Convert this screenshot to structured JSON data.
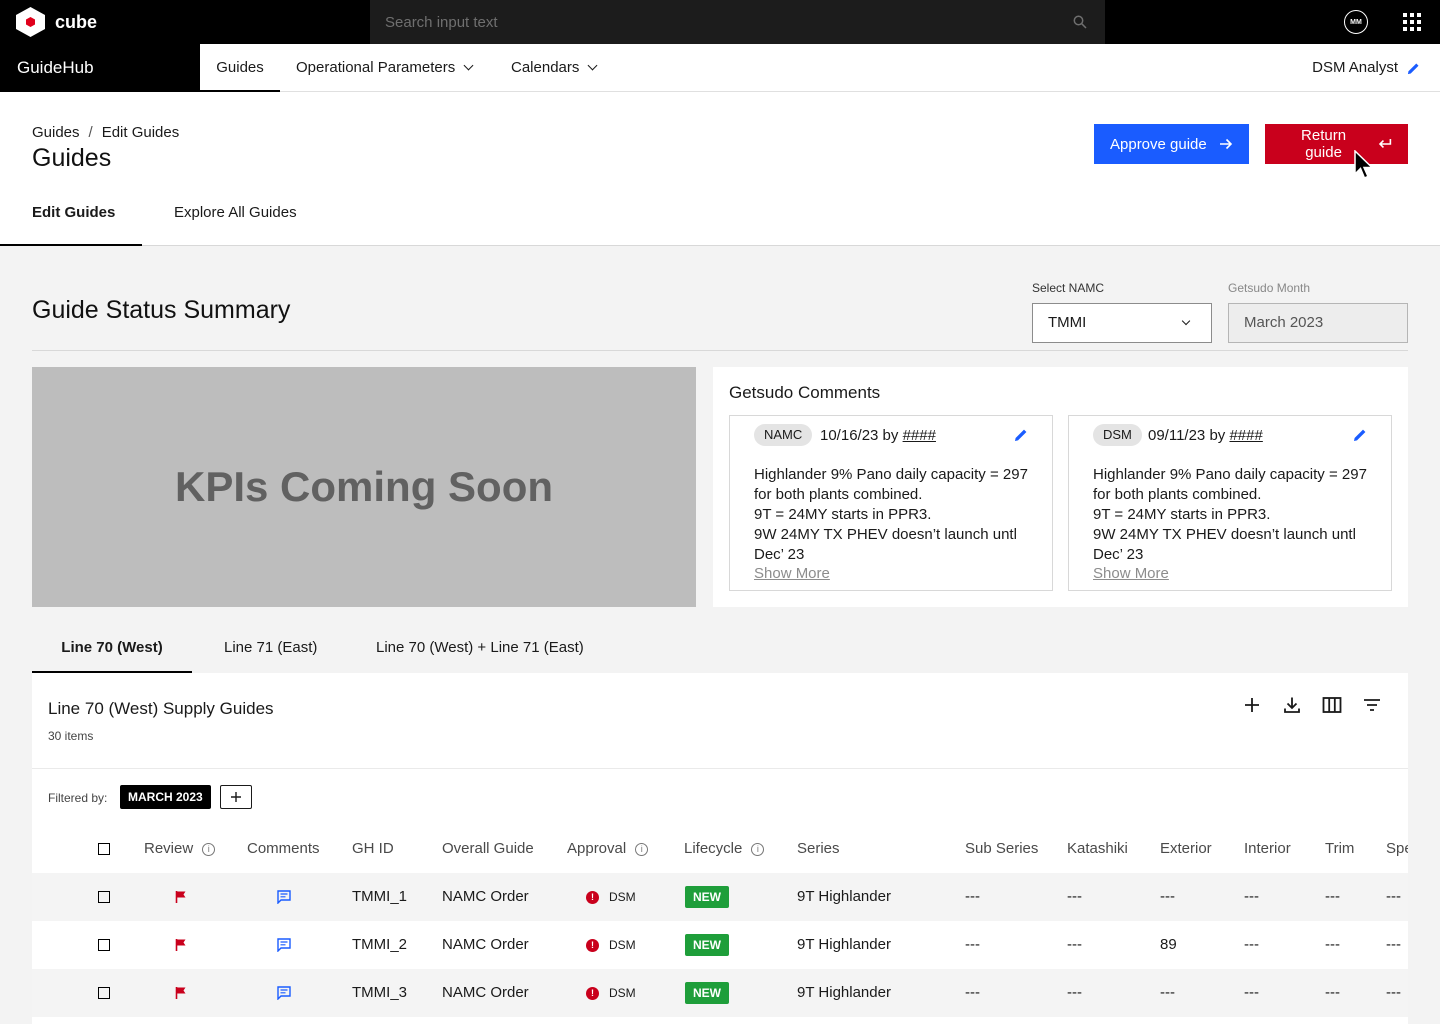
{
  "topbar": {
    "logo_text": "cube",
    "search_placeholder": "Search input text",
    "avatar_initials": "MM"
  },
  "navbar": {
    "brand": "GuideHub",
    "items": [
      {
        "label": "Guides",
        "active": true
      },
      {
        "label": "Operational Parameters",
        "dropdown": true
      },
      {
        "label": "Calendars",
        "dropdown": true
      }
    ],
    "role": "DSM Analyst"
  },
  "header": {
    "breadcrumb": [
      "Guides",
      "Edit Guides"
    ],
    "title": "Guides",
    "approve_label": "Approve guide",
    "return_label": "Return guide",
    "tabs": [
      "Edit Guides",
      "Explore All Guides"
    ]
  },
  "summary": {
    "title": "Guide Status Summary",
    "namc_label": "Select NAMC",
    "namc_value": "TMMI",
    "month_label": "Getsudo Month",
    "month_value": "March 2023",
    "kpi_text": "KPIs Coming Soon"
  },
  "comments": {
    "title": "Getsudo Comments",
    "cards": [
      {
        "chip": "NAMC",
        "date": "10/16/23 by",
        "author": "####",
        "lines": [
          "Highlander 9% Pano daily capacity = 297",
          "for both plants combined.",
          "9T = 24MY starts in PPR3.",
          "9W 24MY TX PHEV doesn’t launch untl",
          "Dec’ 23"
        ],
        "show_more": "Show More"
      },
      {
        "chip": "DSM",
        "date": "09/11/23 by",
        "author": "####",
        "lines": [
          "Highlander 9% Pano daily capacity = 297",
          "for both plants combined.",
          "9T = 24MY starts in PPR3.",
          "9W 24MY TX PHEV doesn’t launch untl",
          "Dec’ 23"
        ],
        "show_more": "Show More"
      }
    ]
  },
  "line_tabs": [
    "Line 70 (West)",
    "Line 71 (East)",
    "Line 70 (West) + Line 71 (East)"
  ],
  "table": {
    "title": "Line 70 (West) Supply Guides",
    "count": "30 items",
    "filtered_by": "Filtered by:",
    "filter_chip": "MARCH 2023",
    "columns": [
      "Review",
      "Comments",
      "GH ID",
      "Overall Guide",
      "Approval",
      "Lifecycle",
      "Series",
      "Sub Series",
      "Katashiki",
      "Exterior",
      "Interior",
      "Trim",
      "Spe"
    ],
    "rows": [
      {
        "gh_id": "TMMI_1",
        "overall": "NAMC Order",
        "approval": "DSM",
        "lifecycle": "NEW",
        "series": "9T Highlander",
        "sub_series": "---",
        "katashiki": "---",
        "exterior": "---",
        "interior": "---",
        "trim": "---",
        "spe": "---"
      },
      {
        "gh_id": "TMMI_2",
        "overall": "NAMC Order",
        "approval": "DSM",
        "lifecycle": "NEW",
        "series": "9T Highlander",
        "sub_series": "---",
        "katashiki": "---",
        "exterior": "89",
        "interior": "---",
        "trim": "---",
        "spe": "---"
      },
      {
        "gh_id": "TMMI_3",
        "overall": "NAMC Order",
        "approval": "DSM",
        "lifecycle": "NEW",
        "series": "9T Highlander",
        "sub_series": "---",
        "katashiki": "---",
        "exterior": "---",
        "interior": "---",
        "trim": "---",
        "spe": "---"
      }
    ]
  },
  "colors": {
    "primary_blue": "#1a5cff",
    "danger_red": "#c9001c",
    "success_green": "#1e9e3a"
  }
}
